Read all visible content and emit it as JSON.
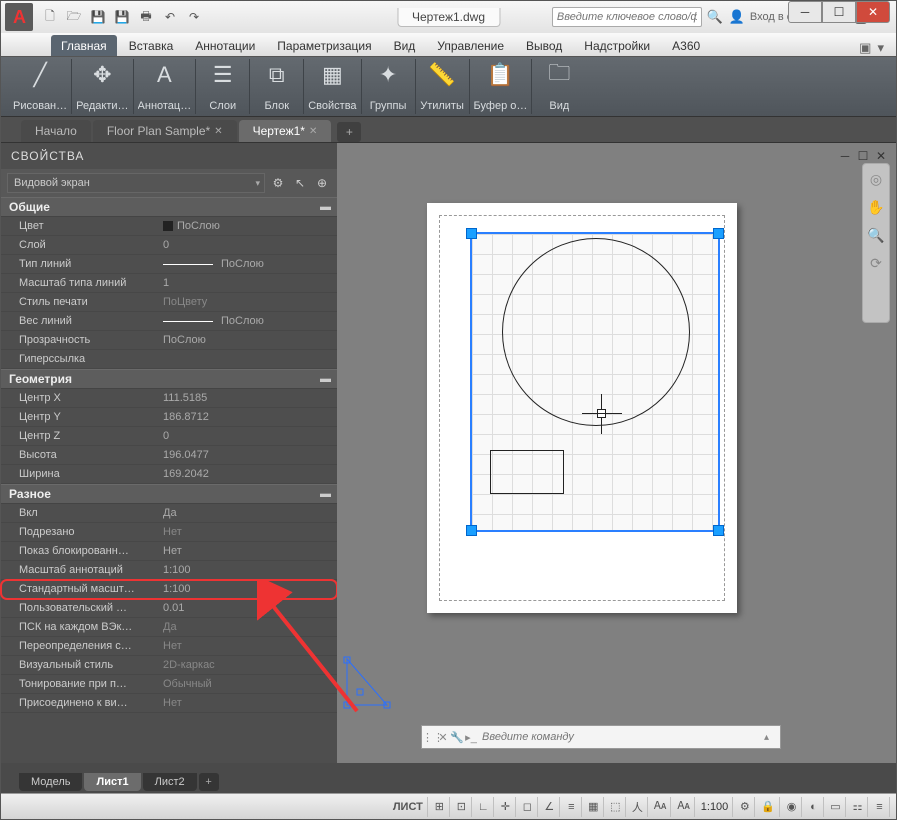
{
  "title_tab": "Чертеж1.dwg",
  "search_placeholder": "Введите ключевое слово/фразу",
  "signin": "Вход в службы",
  "ribbon_tabs": [
    "Главная",
    "Вставка",
    "Аннотации",
    "Параметризация",
    "Вид",
    "Управление",
    "Вывод",
    "Надстройки",
    "A360"
  ],
  "ribbon_panels": [
    {
      "label": "Рисован…",
      "icon": "╱"
    },
    {
      "label": "Редакти…",
      "icon": "✥"
    },
    {
      "label": "Аннотац…",
      "icon": "A"
    },
    {
      "label": "Слои",
      "icon": "☰"
    },
    {
      "label": "Блок",
      "icon": "⧉"
    },
    {
      "label": "Свойства",
      "icon": "▦"
    },
    {
      "label": "Группы",
      "icon": "✦"
    },
    {
      "label": "Утилиты",
      "icon": "📏"
    },
    {
      "label": "Буфер о…",
      "icon": "📋"
    },
    {
      "label": "Вид",
      "icon": "🗀"
    }
  ],
  "file_tabs": [
    {
      "label": "Начало",
      "active": false,
      "closable": false
    },
    {
      "label": "Floor Plan Sample*",
      "active": false,
      "closable": true
    },
    {
      "label": "Чертеж1*",
      "active": true,
      "closable": true
    }
  ],
  "props": {
    "title": "СВОЙСТВА",
    "selector": "Видовой экран",
    "categories": [
      {
        "name": "Общие",
        "rows": [
          {
            "k": "Цвет",
            "v": "ПоСлою",
            "swatch": true
          },
          {
            "k": "Слой",
            "v": "0"
          },
          {
            "k": "Тип линий",
            "v": "ПоСлою",
            "line": true
          },
          {
            "k": "Масштаб типа линий",
            "v": "1"
          },
          {
            "k": "Стиль печати",
            "v": "ПоЦвету",
            "dim": true
          },
          {
            "k": "Вес линий",
            "v": "ПоСлою",
            "line": true
          },
          {
            "k": "Прозрачность",
            "v": "ПоСлою"
          },
          {
            "k": "Гиперссылка",
            "v": ""
          }
        ]
      },
      {
        "name": "Геометрия",
        "rows": [
          {
            "k": "Центр X",
            "v": "111.5185"
          },
          {
            "k": "Центр Y",
            "v": "186.8712"
          },
          {
            "k": "Центр Z",
            "v": "0"
          },
          {
            "k": "Высота",
            "v": "196.0477"
          },
          {
            "k": "Ширина",
            "v": "169.2042"
          }
        ]
      },
      {
        "name": "Разное",
        "rows": [
          {
            "k": "Вкл",
            "v": "Да"
          },
          {
            "k": "Подрезано",
            "v": "Нет",
            "dim": true
          },
          {
            "k": "Показ блокированн…",
            "v": "Нет"
          },
          {
            "k": "Масштаб аннотаций",
            "v": "1:100"
          },
          {
            "k": "Стандартный масшт…",
            "v": "1:100",
            "highlight": true
          },
          {
            "k": "Пользовательский …",
            "v": "0.01"
          },
          {
            "k": "ПСК на каждом ВЭк…",
            "v": "Да",
            "dim": true
          },
          {
            "k": "Переопределения с…",
            "v": "Нет",
            "dim": true
          },
          {
            "k": "Визуальный стиль",
            "v": "2D-каркас",
            "dim": true
          },
          {
            "k": "Тонирование при п…",
            "v": "Обычный",
            "dim": true
          },
          {
            "k": "Присоединено к ви…",
            "v": "Нет",
            "dim": true
          }
        ]
      }
    ]
  },
  "cmd_placeholder": "Введите команду",
  "layout_tabs": [
    {
      "label": "Модель",
      "active": false
    },
    {
      "label": "Лист1",
      "active": true
    },
    {
      "label": "Лист2",
      "active": false
    }
  ],
  "status": {
    "mode": "ЛИСТ",
    "scale": "1:100"
  }
}
